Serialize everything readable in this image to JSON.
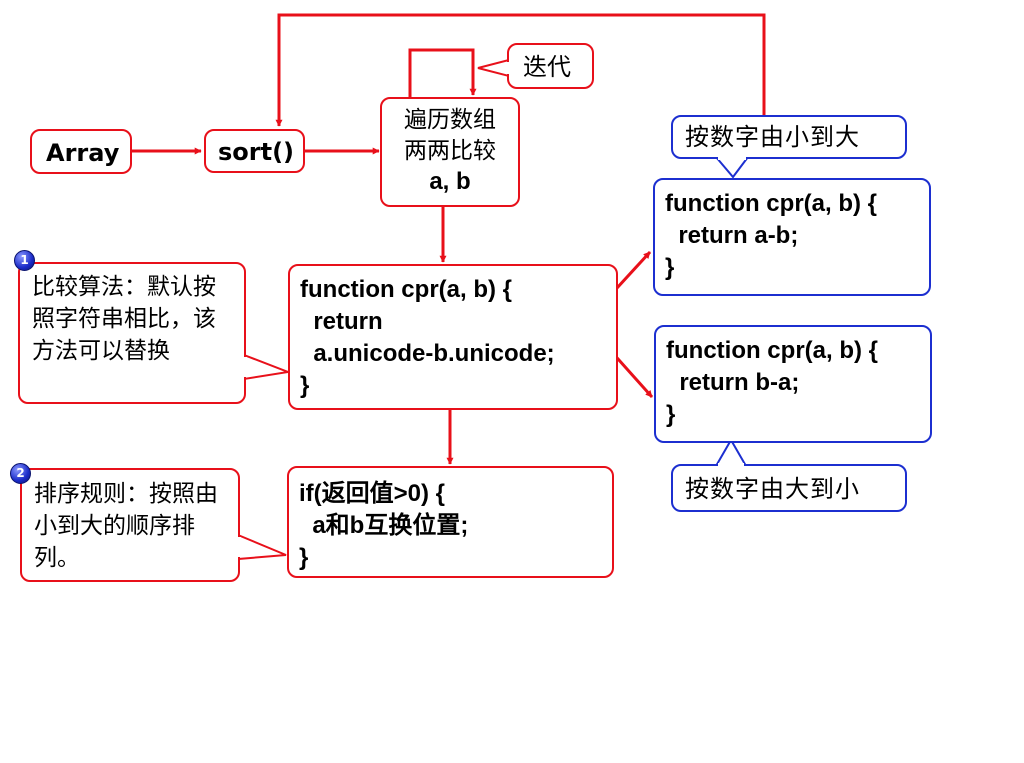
{
  "nodes": {
    "array": "Array",
    "sort": "sort()",
    "iterate": "迭代",
    "traverse": [
      "遍历数组",
      "两两比较",
      "a, b"
    ],
    "default_fn": [
      "function cpr(a, b) {",
      "  return",
      "  a.unicode-b.unicode;",
      "}"
    ],
    "swap_rule": [
      "if(返回值>0) {",
      "  a和b互换位置;",
      "}"
    ],
    "asc_fn": [
      "function cpr(a, b) {",
      "  return a-b;",
      "}"
    ],
    "desc_fn": [
      "function cpr(a, b) {",
      "  return b-a;",
      "}"
    ]
  },
  "callouts": {
    "note1": {
      "badge": "1",
      "text": "比较算法：默认按照字符串相比，该方法可以替换"
    },
    "note2": {
      "badge": "2",
      "text": "排序规则：按照由小到大的顺序排列。"
    },
    "ascending": "按数字由小到大",
    "descending": "按数字由大到小"
  },
  "colors": {
    "red": "#e8101a",
    "blue": "#1c2fd0"
  }
}
